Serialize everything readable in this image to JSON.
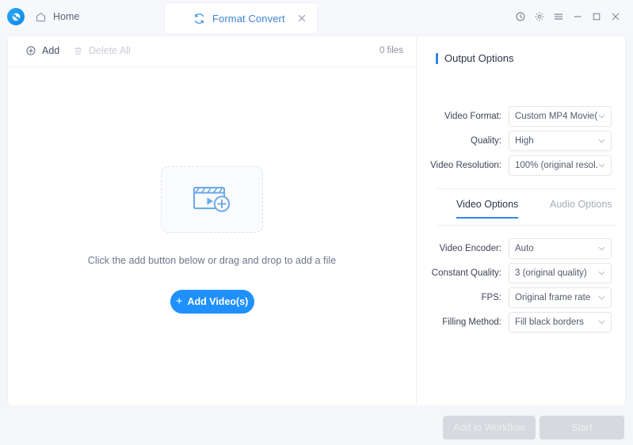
{
  "window": {
    "logo_icon": "app-logo-swirl",
    "home_label": "Home",
    "home_icon": "home-icon",
    "controls": [
      {
        "name": "history-icon",
        "glyph": "clock"
      },
      {
        "name": "settings-icon",
        "glyph": "gear"
      },
      {
        "name": "menu-icon",
        "glyph": "hamburger"
      },
      {
        "name": "minimize-icon",
        "glyph": "minimize"
      },
      {
        "name": "maximize-icon",
        "glyph": "maximize"
      },
      {
        "name": "close-icon",
        "glyph": "close"
      }
    ]
  },
  "tab": {
    "label": "Format Convert",
    "icon": "convert-refresh-icon",
    "close_icon": "close-icon"
  },
  "toolbar": {
    "add_label": "Add",
    "add_icon": "plus-circle-icon",
    "delete_all_label": "Delete All",
    "delete_all_icon": "trash-icon",
    "file_count": "0 files"
  },
  "dropzone": {
    "icon": "video-add-clapperboard-icon",
    "hint": "Click the add button below or drag and drop to add a file",
    "button_label": "Add Video(s)",
    "button_plus": "+"
  },
  "output_options": {
    "title": "Output Options",
    "fields": [
      {
        "label": "Video Format:",
        "value": "Custom MP4 Movie(...",
        "name": "video-format"
      },
      {
        "label": "Quality:",
        "value": "High",
        "name": "quality"
      },
      {
        "label": "Video Resolution:",
        "value": "100% (original resol...",
        "name": "video-resolution"
      }
    ]
  },
  "option_tabs": {
    "video_label": "Video Options",
    "audio_label": "Audio Options",
    "active": "Video Options"
  },
  "video_options": {
    "fields": [
      {
        "label": "Video Encoder:",
        "value": "Auto",
        "name": "video-encoder"
      },
      {
        "label": "Constant Quality:",
        "value": "3 (original quality)",
        "name": "constant-quality"
      },
      {
        "label": "FPS:",
        "value": "Original frame rate",
        "name": "fps"
      },
      {
        "label": "Filling Method:",
        "value": "Fill black borders",
        "name": "filling-method"
      }
    ]
  },
  "footer": {
    "add_to_workflow_label": "Add to Workflow",
    "start_label": "Start"
  },
  "colors": {
    "accent": "#2f86e8",
    "primary_button": "#1e90ff",
    "tab_text": "#3f83d6",
    "disabled_button": "#d7d9de",
    "page_background": "#f4f6fa"
  }
}
